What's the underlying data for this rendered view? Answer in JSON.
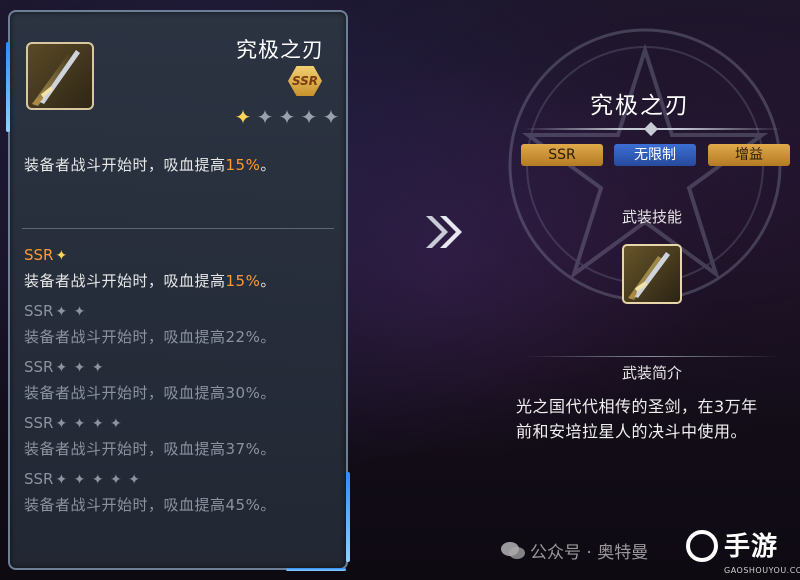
{
  "item": {
    "name": "究极之刃",
    "rarity": "SSR",
    "star_level": 1,
    "star_max": 5,
    "current_effect": {
      "text": "装备者战斗开始时，吸血提高",
      "pct": "15%",
      "suffix": "。"
    }
  },
  "levels": [
    {
      "label": "SSR",
      "stars": 1,
      "text": "装备者战斗开始时，吸血提高",
      "pct": "15%",
      "suffix": "。",
      "active": true
    },
    {
      "label": "SSR",
      "stars": 2,
      "text": "装备者战斗开始时，吸血提高22%。",
      "active": false
    },
    {
      "label": "SSR",
      "stars": 3,
      "text": "装备者战斗开始时，吸血提高30%。",
      "active": false
    },
    {
      "label": "SSR",
      "stars": 4,
      "text": "装备者战斗开始时，吸血提高37%。",
      "active": false
    },
    {
      "label": "SSR",
      "stars": 5,
      "text": "装备者战斗开始时，吸血提高45%。",
      "active": false
    }
  ],
  "detail": {
    "title": "究极之刃",
    "tags": [
      "SSR",
      "无限制",
      "增益"
    ],
    "skill_label": "武装技能",
    "intro_label": "武装简介",
    "intro_line1": "光之国代代相传的圣剑，在3万年",
    "intro_line2": "前和安培拉星人的决斗中使用。"
  },
  "watermark": {
    "text": "公众号 · 奥特曼",
    "brand": "手游",
    "url": "GAOSHOUYOU.COM"
  },
  "colors": {
    "accent_orange": "#ff9a2e",
    "tag_gold": "#c98f33",
    "tag_blue": "#3460c0"
  },
  "icons": {
    "weapon": "sword-icon",
    "arrow": "double-chevron-right-icon",
    "star": "star-icon"
  }
}
